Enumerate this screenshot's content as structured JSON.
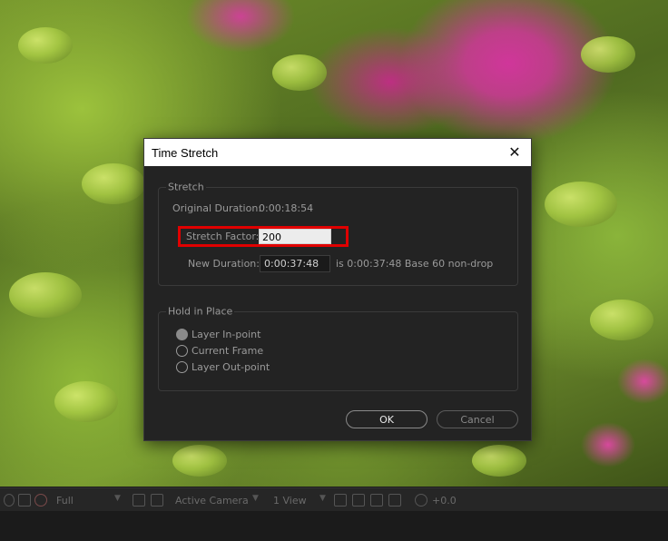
{
  "dialog": {
    "title": "Time Stretch",
    "close_glyph": "✕",
    "stretch_group": {
      "title": "Stretch",
      "original_duration_label": "Original Duration:",
      "original_duration_value": "0:00:18:54",
      "stretch_factor_label": "Stretch Factor:",
      "stretch_factor_value": "200",
      "new_duration_label": "New Duration:",
      "new_duration_value": "0:00:37:48",
      "new_duration_info": "is 0:00:37:48  Base 60  non-drop"
    },
    "hold_group": {
      "title": "Hold in Place",
      "options": [
        {
          "label": "Layer In-point",
          "selected": true
        },
        {
          "label": "Current Frame",
          "selected": false
        },
        {
          "label": "Layer Out-point",
          "selected": false
        }
      ]
    },
    "ok_label": "OK",
    "cancel_label": "Cancel"
  },
  "toolbar": {
    "resolution": "Full",
    "view_camera": "Active Camera",
    "views": "1 View",
    "exposure": "+0.0"
  },
  "colors": {
    "dialog_bg": "#232323",
    "highlight": "#e00000",
    "titlebar_bg": "#ffffff"
  }
}
